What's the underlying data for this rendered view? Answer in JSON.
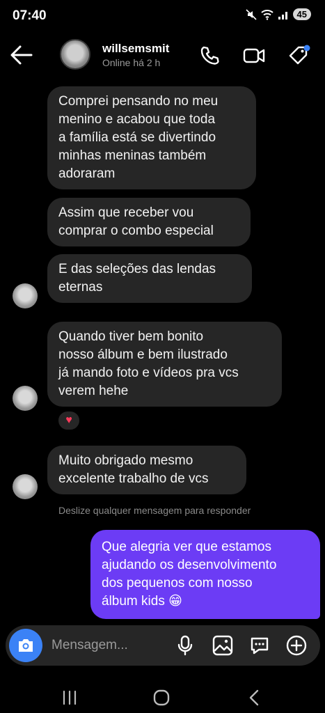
{
  "status_bar": {
    "time": "07:40",
    "battery": "45"
  },
  "header": {
    "username": "willsemsmit",
    "status": "Online há 2 h"
  },
  "messages_in": [
    "Comprei pensando no meu\nmenino e acabou que toda\na família está se divertindo\nminhas meninas também\nadoraram",
    "Assim que receber vou\ncomprar o combo especial",
    "E das seleções das lendas\neternas",
    "Quando tiver bem bonito\nnosso álbum e bem ilustrado\njá mando foto e vídeos pra vcs\nverem hehe",
    "Muito obrigado mesmo\nexcelente trabalho de vcs"
  ],
  "reaction": "♥",
  "swipe_hint": "Deslize qualquer mensagem para responder",
  "message_out": "Que alegria ver que estamos\najudando os desenvolvimento\ndos pequenos com nosso\nálbum kids 😁",
  "composer": {
    "placeholder": "Mensagem..."
  },
  "icons": {
    "header": [
      "back-arrow-icon",
      "phone-icon",
      "video-icon",
      "tag-icon"
    ],
    "composer": [
      "camera-icon",
      "microphone-icon",
      "image-icon",
      "sticker-icon",
      "plus-icon"
    ],
    "nav": [
      "recent-apps-icon",
      "home-icon",
      "back-icon"
    ]
  },
  "colors": {
    "outgoing_bubble": "#6c3cf5",
    "incoming_bubble": "#262626",
    "camera_button": "#3b82f6",
    "tag_badge": "#3b82f6"
  }
}
